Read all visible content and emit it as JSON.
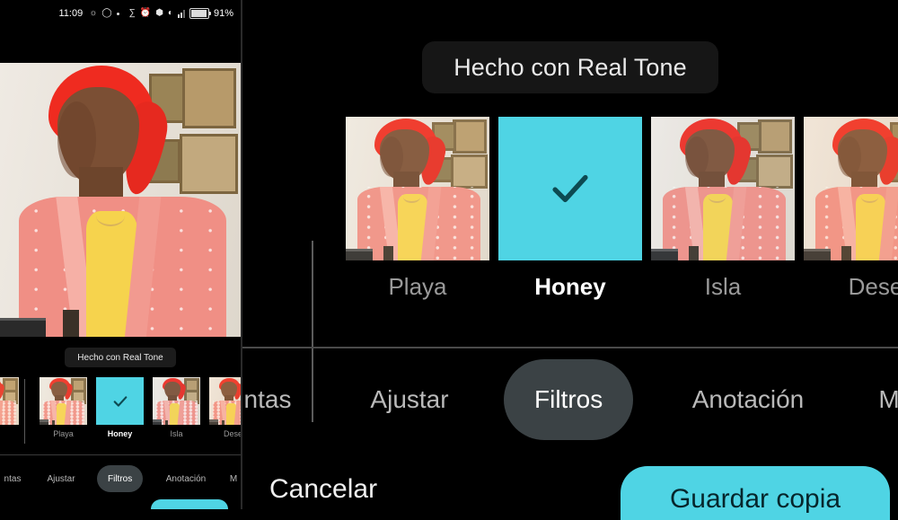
{
  "app": {
    "tooltip_text": "Hecho con Real Tone",
    "accent_color": "#4fd4e4",
    "background_color": "#000000"
  },
  "status_bar": {
    "time": "11:09",
    "battery_percent": "91%",
    "icons": [
      "vibrate-icon",
      "circle-icon",
      "dot-icon",
      "nfc-icon",
      "alarm-icon",
      "bluetooth-icon",
      "wifi-icon",
      "signal-icon",
      "battery-icon"
    ]
  },
  "filters": {
    "items": [
      {
        "label": "",
        "type": "photo",
        "selected": false,
        "tint": "rgba(255,210,150,0.16)"
      },
      {
        "label": "Playa",
        "type": "photo",
        "selected": false,
        "tint": "rgba(255,235,200,0.10)"
      },
      {
        "label": "Honey",
        "type": "swatch",
        "selected": true,
        "tint": ""
      },
      {
        "label": "Isla",
        "type": "photo",
        "selected": false,
        "tint": "rgba(200,235,255,0.08)"
      },
      {
        "label": "Dese",
        "type": "photo",
        "selected": false,
        "tint": "rgba(255,200,140,0.14)"
      }
    ],
    "check_icon": "check-icon"
  },
  "tabs": {
    "items": [
      {
        "label": "ntas",
        "active": false
      },
      {
        "label": "Ajustar",
        "active": false
      },
      {
        "label": "Filtros",
        "active": true
      },
      {
        "label": "Anotación",
        "active": false
      },
      {
        "label": "M",
        "active": false
      }
    ]
  },
  "actions": {
    "cancel_label": "Cancelar",
    "save_label": "Guardar copia"
  }
}
